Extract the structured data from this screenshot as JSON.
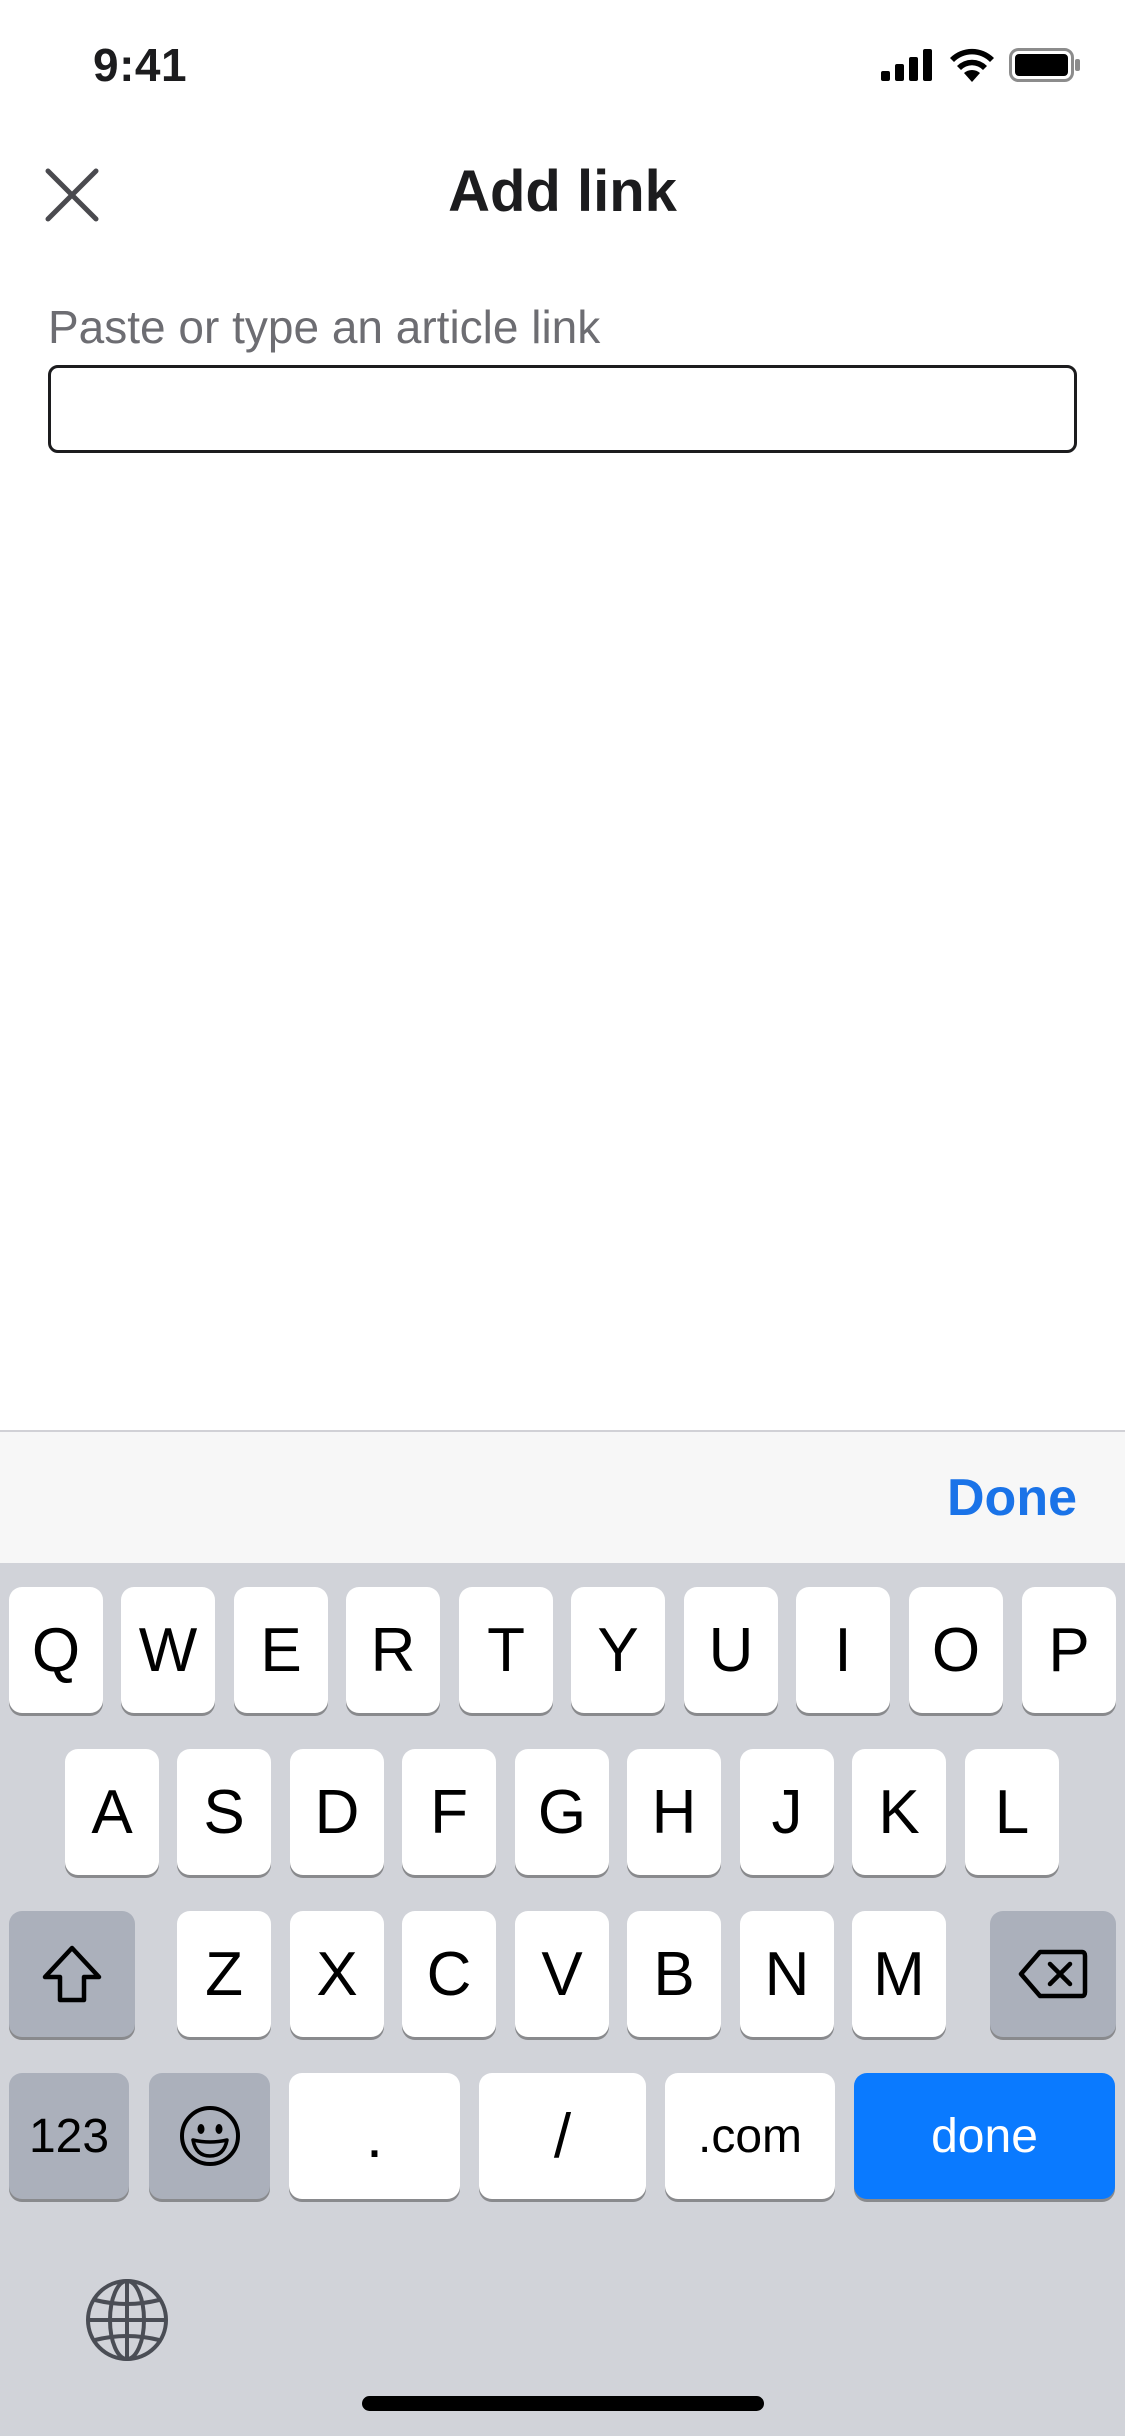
{
  "status": {
    "time": "9:41",
    "icons": [
      "cellular-signal-icon",
      "wifi-icon",
      "battery-icon"
    ]
  },
  "header": {
    "title": "Add link",
    "close_icon": "close-icon"
  },
  "form": {
    "label": "Paste or type an article link",
    "value": "",
    "placeholder": ""
  },
  "accessory": {
    "done_label": "Done"
  },
  "keyboard": {
    "row1": [
      "Q",
      "W",
      "E",
      "R",
      "T",
      "Y",
      "U",
      "I",
      "O",
      "P"
    ],
    "row2": [
      "A",
      "S",
      "D",
      "F",
      "G",
      "H",
      "J",
      "K",
      "L"
    ],
    "row3": [
      "Z",
      "X",
      "C",
      "V",
      "B",
      "N",
      "M"
    ],
    "numbers_label": "123",
    "dot_label": ".",
    "slash_label": "/",
    "com_label": ".com",
    "done_label": "done",
    "icons": [
      "shift-icon",
      "backspace-icon",
      "emoji-icon",
      "globe-icon"
    ]
  },
  "colors": {
    "accent": "#0a7aff",
    "link": "#1a73e8",
    "keyboard_bg": "#d1d3d9"
  }
}
